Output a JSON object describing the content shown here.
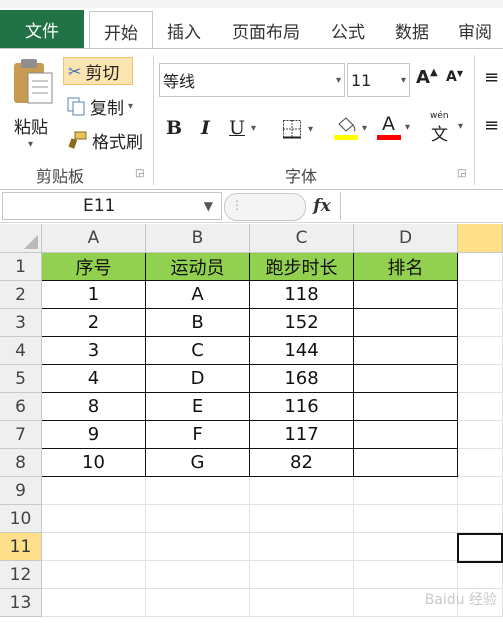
{
  "tabs": [
    "文件",
    "开始",
    "插入",
    "页面布局",
    "公式",
    "数据",
    "审阅"
  ],
  "clipboard": {
    "paste": "粘贴",
    "cut": "剪切",
    "copy": "复制",
    "format_painter": "格式刷",
    "group": "剪贴板"
  },
  "font": {
    "name": "等线",
    "size": "11",
    "bold": "B",
    "italic": "I",
    "underline": "U",
    "group": "字体",
    "phonetic": "wén"
  },
  "formula_bar": {
    "name_box": "E11",
    "fx": "fx",
    "value": ""
  },
  "columns": [
    "A",
    "B",
    "C",
    "D"
  ],
  "rows": [
    "1",
    "2",
    "3",
    "4",
    "5",
    "6",
    "7",
    "8",
    "9",
    "10",
    "11",
    "12",
    "13"
  ],
  "selected_row": "11",
  "selected_cell": "E11",
  "table": {
    "headers": [
      "序号",
      "运动员",
      "跑步时长",
      "排名"
    ],
    "data": [
      [
        "1",
        "A",
        "118",
        ""
      ],
      [
        "2",
        "B",
        "152",
        ""
      ],
      [
        "3",
        "C",
        "144",
        ""
      ],
      [
        "4",
        "D",
        "168",
        ""
      ],
      [
        "8",
        "E",
        "116",
        ""
      ],
      [
        "9",
        "F",
        "117",
        ""
      ],
      [
        "10",
        "G",
        "82",
        ""
      ]
    ]
  },
  "colors": {
    "file_tab": "#217346",
    "header_fill": "#92d050",
    "selected_header": "#ffe08a"
  },
  "watermark": "Baidu 经验"
}
